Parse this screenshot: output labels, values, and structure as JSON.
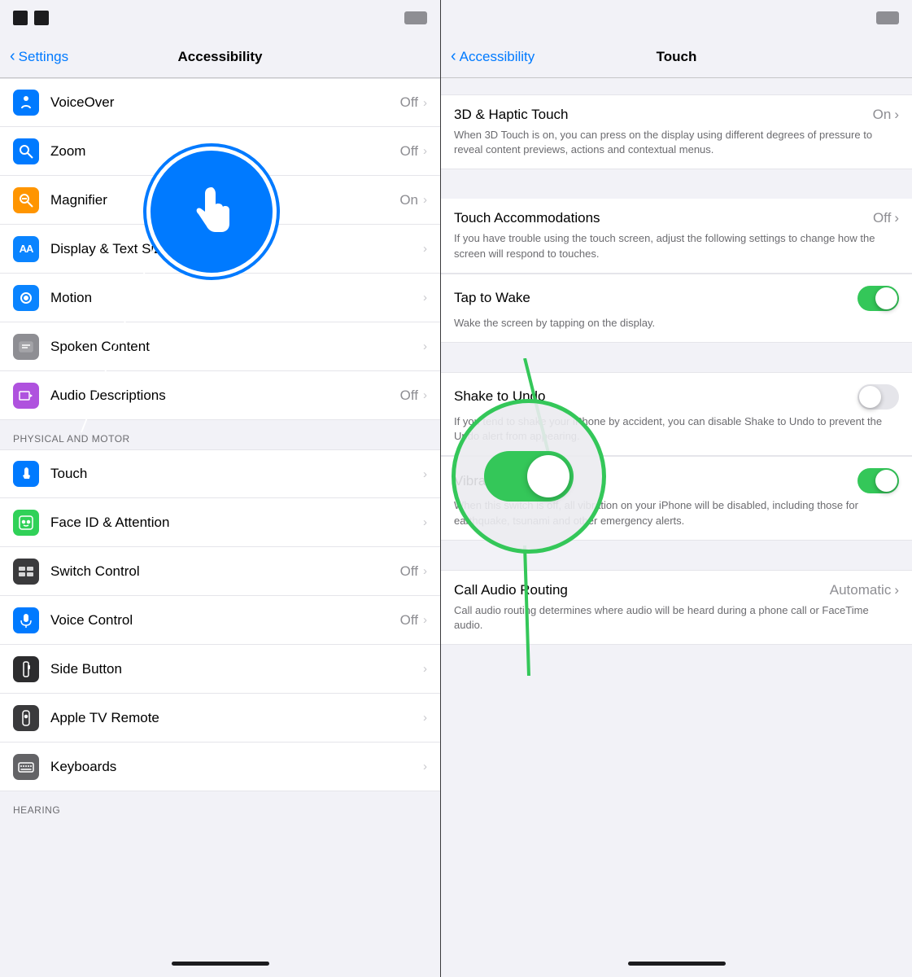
{
  "left": {
    "statusBar": {
      "battery": ""
    },
    "navBar": {
      "backLabel": "Settings",
      "title": "Accessibility"
    },
    "items": [
      {
        "id": "voiceover",
        "label": "VoiceOver",
        "value": "Off",
        "hasChevron": true,
        "iconColor": "blue",
        "iconChar": "👁"
      },
      {
        "id": "zoom",
        "label": "Zoom",
        "value": "Off",
        "hasChevron": true,
        "iconColor": "blue",
        "iconChar": "🔍"
      },
      {
        "id": "magnifier",
        "label": "Magnifier",
        "value": "On",
        "hasChevron": true,
        "iconColor": "orange",
        "iconChar": "🔎"
      },
      {
        "id": "display-text",
        "label": "Display & Text Size",
        "value": "",
        "hasChevron": true,
        "iconColor": "blue2",
        "iconChar": "AA"
      },
      {
        "id": "motion",
        "label": "Motion",
        "value": "",
        "hasChevron": true,
        "iconColor": "blue2",
        "iconChar": "⊙"
      },
      {
        "id": "spoken-content",
        "label": "Spoken Content",
        "value": "",
        "hasChevron": true,
        "iconColor": "gray",
        "iconChar": "💬"
      },
      {
        "id": "audio-descriptions",
        "label": "Audio Descriptions",
        "value": "Off",
        "hasChevron": true,
        "iconColor": "purple",
        "iconChar": "💬"
      }
    ],
    "sectionPhysical": "PHYSICAL AND MOTOR",
    "physicalItems": [
      {
        "id": "touch",
        "label": "Touch",
        "value": "",
        "hasChevron": true,
        "highlighted": true
      },
      {
        "id": "face-id",
        "label": "Face ID & Attention",
        "value": "",
        "hasChevron": true
      },
      {
        "id": "switch-control",
        "label": "Switch Control",
        "value": "Off",
        "hasChevron": true
      },
      {
        "id": "voice-control",
        "label": "Voice Control",
        "value": "Off",
        "hasChevron": true
      },
      {
        "id": "side-button",
        "label": "Side Button",
        "value": "",
        "hasChevron": true
      },
      {
        "id": "apple-tv-remote",
        "label": "Apple TV Remote",
        "value": "",
        "hasChevron": true
      },
      {
        "id": "keyboards",
        "label": "Keyboards",
        "value": "",
        "hasChevron": true
      }
    ],
    "sectionHearing": "HEARING"
  },
  "right": {
    "statusBar": {
      "battery": ""
    },
    "navBar": {
      "backLabel": "Accessibility",
      "title": "Touch"
    },
    "items": [
      {
        "id": "3d-haptic",
        "title": "3D & Haptic Touch",
        "value": "On",
        "hasChevron": true,
        "hasToggle": false,
        "desc": "When 3D Touch is on, you can press on the display using different degrees of pressure to reveal content previews, actions and contextual menus."
      },
      {
        "id": "touch-accommodations",
        "title": "Touch Accommodations",
        "value": "Off",
        "hasChevron": true,
        "hasToggle": false,
        "desc": "If you have trouble using the touch screen, adjust the following settings to change how the screen will respond to touches."
      },
      {
        "id": "tap-to-wake",
        "title": "Tap to Wake",
        "value": "",
        "hasChevron": false,
        "hasToggle": true,
        "toggleOn": true,
        "desc": "Wake the screen by tapping on the display."
      },
      {
        "id": "shake-to-undo",
        "title": "Shake to Undo",
        "value": "",
        "hasChevron": false,
        "hasToggle": true,
        "toggleOn": false,
        "desc": "If you tend to shake your iPhone by accident, you can disable Shake to Undo to prevent the Undo alert from appearing."
      },
      {
        "id": "vibration",
        "title": "Vibration",
        "value": "",
        "hasChevron": false,
        "hasToggle": true,
        "toggleOn": true,
        "desc": "When this switch is off, all vibration on your iPhone will be disabled, including those for earthquake, tsunami and other emergency alerts."
      },
      {
        "id": "call-audio-routing",
        "title": "Call Audio Routing",
        "value": "Automatic",
        "hasChevron": true,
        "hasToggle": false,
        "desc": "Call audio routing determines where audio will be heard during a phone call or FaceTime audio."
      }
    ]
  }
}
